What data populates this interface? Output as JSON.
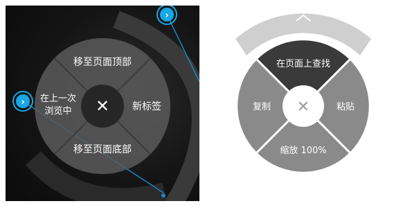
{
  "dark_menu": {
    "top_label": "移至页面顶部",
    "bottom_label": "移至页面底部",
    "left_label_line1": "在上一次",
    "left_label_line2": "浏览中",
    "right_label": "新标签",
    "close_glyph": "✕",
    "accent_color": "#19a7e6"
  },
  "light_menu": {
    "top_label": "在页面上查找",
    "left_label": "复制",
    "right_label": "粘贴",
    "bottom_label": "缩放 100%",
    "close_glyph": "✕",
    "accent_color": "#3a3a3a",
    "ring_color": "#cfcfcf"
  }
}
